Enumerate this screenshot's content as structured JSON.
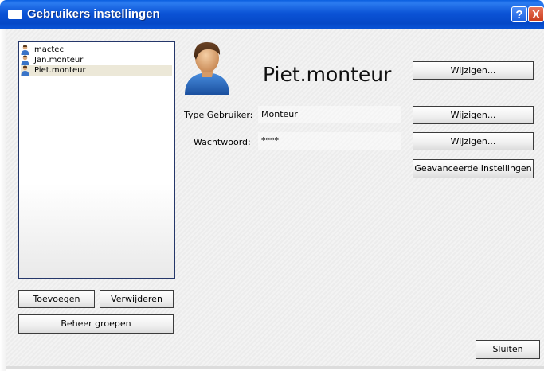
{
  "window": {
    "title": "Gebruikers instellingen",
    "help_label": "?",
    "close_label": "X"
  },
  "users": [
    {
      "label": "mactec",
      "selected": false
    },
    {
      "label": "Jan.monteur",
      "selected": false
    },
    {
      "label": "Piet.monteur",
      "selected": true
    }
  ],
  "list_buttons": {
    "add": "Toevoegen",
    "remove": "Verwijderen",
    "groups": "Beheer groepen"
  },
  "detail": {
    "username": "Piet.monteur",
    "change_name": "Wijzigen...",
    "type_label": "Type Gebruiker:",
    "type_value": "Monteur",
    "change_type": "Wijzigen...",
    "password_label": "Wachtwoord:",
    "password_value": "****",
    "change_password": "Wijzigen...",
    "advanced": "Geavanceerde Instellingen"
  },
  "footer": {
    "close": "Sluiten"
  },
  "colors": {
    "titlebar": "#0b53d6",
    "list_border": "#25376a",
    "selected_row": "#ece8d8"
  },
  "icons": [
    "user-icon",
    "avatar-icon",
    "help-icon",
    "close-icon",
    "window-icon"
  ]
}
